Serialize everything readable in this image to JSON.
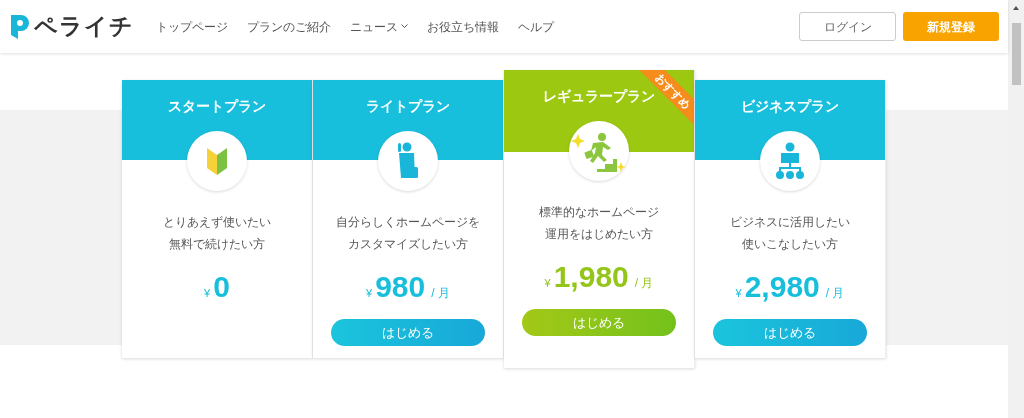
{
  "header": {
    "logo": "ペライチ",
    "nav": [
      {
        "label": "トップページ",
        "has_dropdown": false
      },
      {
        "label": "プランのご紹介",
        "has_dropdown": false
      },
      {
        "label": "ニュース",
        "has_dropdown": true
      },
      {
        "label": "お役立ち情報",
        "has_dropdown": false
      },
      {
        "label": "ヘルプ",
        "has_dropdown": false
      }
    ],
    "login": "ログイン",
    "signup": "新規登録"
  },
  "plans": [
    {
      "name": "スタートプラン",
      "featured": false,
      "description": [
        "とりあえず使いたい",
        "無料で続けたい方"
      ],
      "currency": "¥",
      "price": "0"
    },
    {
      "name": "ライトプラン",
      "featured": false,
      "description": [
        "自分らしくホームページを",
        "カスタマイズしたい方"
      ],
      "currency": "¥",
      "price": "980",
      "per": "/ 月",
      "button": "はじめる"
    },
    {
      "name": "レギュラープラン",
      "featured": true,
      "badge": "おすすめ",
      "description": [
        "標準的なホームページ",
        "運用をはじめたい方"
      ],
      "currency": "¥",
      "price": "1,980",
      "per": "/ 月",
      "button": "はじめる"
    },
    {
      "name": "ビジネスプラン",
      "featured": false,
      "description": [
        "ビジネスに活用したい",
        "使いこなしたい方"
      ],
      "currency": "¥",
      "price": "2,980",
      "per": "/ 月",
      "button": "はじめる"
    }
  ]
}
